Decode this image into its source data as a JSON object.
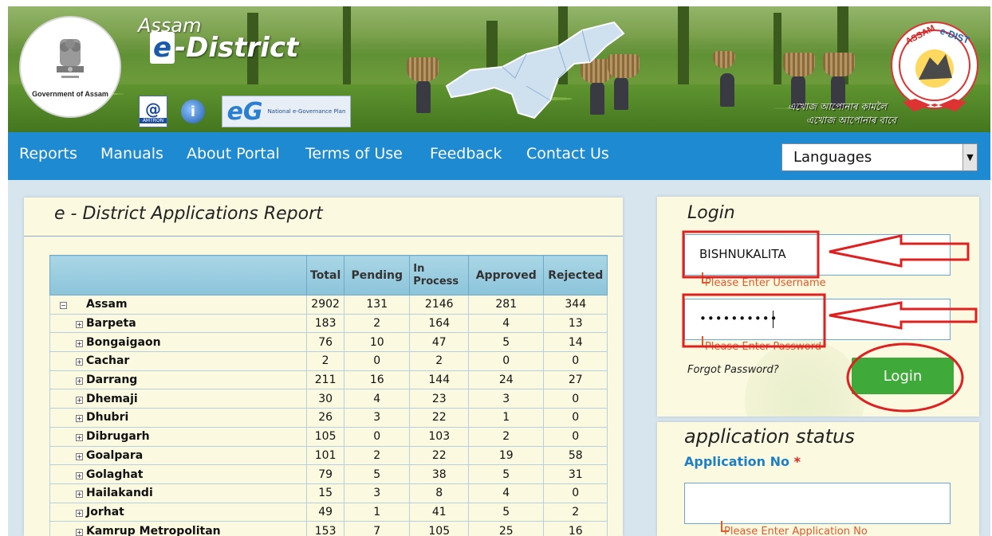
{
  "header": {
    "brand_assam": "Assam",
    "brand_edistrict_e": "e",
    "brand_edistrict_rest": "-District",
    "gov_label": "Government of Assam",
    "amtron_label": "AMTRON",
    "egov_text": "National e-Governance Plan",
    "tagline_line1": "এখোজ আপোনাৰ কামলৈ",
    "tagline_line2": "এখোজ আপোনাৰ বাবে",
    "right_logo_text": "ASSAM e-DISTRICT"
  },
  "nav": {
    "items": [
      "Reports",
      "Manuals",
      "About Portal",
      "Terms of Use",
      "Feedback",
      "Contact Us"
    ],
    "languages_label": "Languages"
  },
  "report": {
    "title": "e - District Applications Report",
    "columns": [
      "Total",
      "Pending",
      "In Process",
      "Approved",
      "Rejected"
    ],
    "rows": [
      {
        "name": "Assam",
        "level": "root",
        "toggle": "−",
        "values": [
          2902,
          131,
          2146,
          281,
          344
        ]
      },
      {
        "name": "Barpeta",
        "level": "child",
        "toggle": "+",
        "values": [
          183,
          2,
          164,
          4,
          13
        ]
      },
      {
        "name": "Bongaigaon",
        "level": "child",
        "toggle": "+",
        "values": [
          76,
          10,
          47,
          5,
          14
        ]
      },
      {
        "name": "Cachar",
        "level": "child",
        "toggle": "+",
        "values": [
          2,
          0,
          2,
          0,
          0
        ]
      },
      {
        "name": "Darrang",
        "level": "child",
        "toggle": "+",
        "values": [
          211,
          16,
          144,
          24,
          27
        ]
      },
      {
        "name": "Dhemaji",
        "level": "child",
        "toggle": "+",
        "values": [
          30,
          4,
          23,
          3,
          0
        ]
      },
      {
        "name": "Dhubri",
        "level": "child",
        "toggle": "+",
        "values": [
          26,
          3,
          22,
          1,
          0
        ]
      },
      {
        "name": "Dibrugarh",
        "level": "child",
        "toggle": "+",
        "values": [
          105,
          0,
          103,
          2,
          0
        ]
      },
      {
        "name": "Goalpara",
        "level": "child",
        "toggle": "+",
        "values": [
          101,
          2,
          22,
          19,
          58
        ]
      },
      {
        "name": "Golaghat",
        "level": "child",
        "toggle": "+",
        "values": [
          79,
          5,
          38,
          5,
          31
        ]
      },
      {
        "name": "Hailakandi",
        "level": "child",
        "toggle": "+",
        "values": [
          15,
          3,
          8,
          4,
          0
        ]
      },
      {
        "name": "Jorhat",
        "level": "child",
        "toggle": "+",
        "values": [
          49,
          1,
          41,
          5,
          2
        ]
      },
      {
        "name": "Kamrup Metropolitan",
        "level": "child",
        "toggle": "+",
        "values": [
          153,
          7,
          105,
          25,
          16
        ]
      }
    ]
  },
  "login": {
    "title": "Login",
    "username_value": "BISHNUKALITA",
    "username_error": "Please Enter Username",
    "password_value": "••••••••••",
    "password_error": "Please Enter Password",
    "forgot_label": "Forgot Password?",
    "login_button": "Login"
  },
  "status": {
    "title": "application status",
    "app_no_label": "Application No",
    "required_mark": "*",
    "app_no_error": "Please Enter Application No"
  },
  "colors": {
    "nav_blue": "#1d8ad2",
    "login_green": "#3faa3a",
    "annotation_red": "#e02020",
    "panel_cream": "#fbf9e0"
  }
}
